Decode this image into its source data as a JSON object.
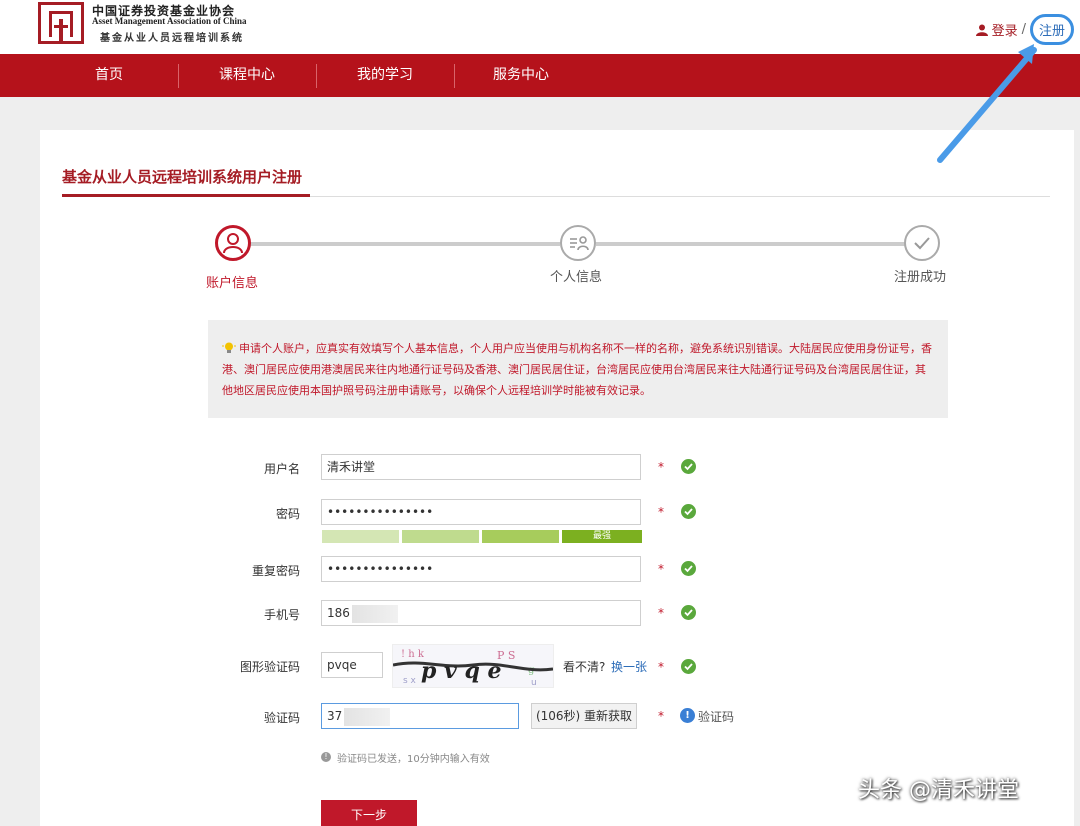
{
  "header": {
    "org_cn": "中国证券投资基金业协会",
    "org_en": "Asset Management Association of China",
    "system_name": "基金从业人员远程培训系统",
    "login": "登录",
    "separator": "/",
    "register": "注册"
  },
  "nav": {
    "items": [
      {
        "label": "首页"
      },
      {
        "label": "课程中心"
      },
      {
        "label": "我的学习"
      },
      {
        "label": "服务中心"
      }
    ]
  },
  "page": {
    "title": "基金从业人员远程培训系统用户注册"
  },
  "steps": [
    {
      "label": "账户信息",
      "state": "active"
    },
    {
      "label": "个人信息",
      "state": "pending"
    },
    {
      "label": "注册成功",
      "state": "pending"
    }
  ],
  "notice": "申请个人账户，应真实有效填写个人基本信息，个人用户应当使用与机构名称不一样的名称，避免系统识别错误。大陆居民应使用身份证号，香港、澳门居民应使用港澳居民来往内地通行证号码及香港、澳门居民居住证，台湾居民应使用台湾居民来往大陆通行证号码及台湾居民居住证，其他地区居民应使用本国护照号码注册申请账号，以确保个人远程培训学时能被有效记录。",
  "form": {
    "username": {
      "label": "用户名",
      "value": "清禾讲堂"
    },
    "password": {
      "label": "密码",
      "value": "•••••••••••••••",
      "strength": "最强"
    },
    "confirm_password": {
      "label": "重复密码",
      "value": "•••••••••••••••"
    },
    "phone": {
      "label": "手机号",
      "value": "186"
    },
    "captcha": {
      "label": "图形验证码",
      "value": "pvqe",
      "unclear": "看不清?",
      "refresh": "换一张"
    },
    "sms_code": {
      "label": "验证码",
      "value": "37",
      "resend": "(106秒) 重新获取",
      "hint": "验证码"
    },
    "required_mark": "*",
    "sent_notice": "验证码已发送，10分钟内输入有效",
    "next": "下一步"
  },
  "watermark": "头条 @清禾讲堂",
  "colors": {
    "brand_red": "#b5121b",
    "success_green": "#5aa83c",
    "link_blue": "#2c6cb8"
  }
}
